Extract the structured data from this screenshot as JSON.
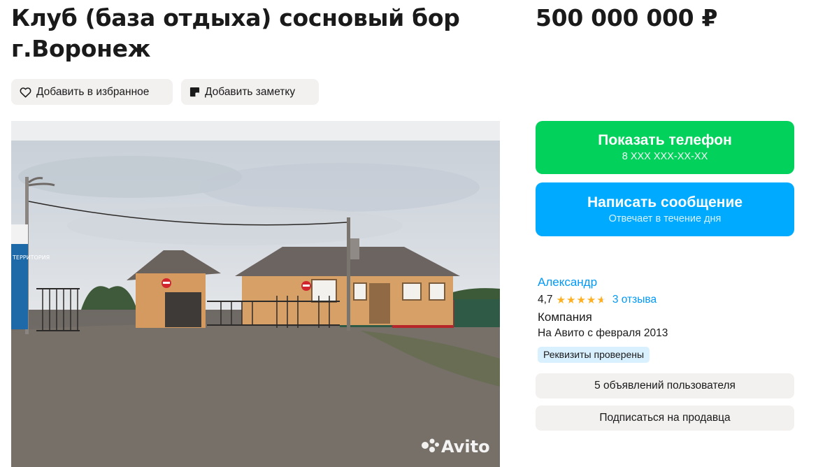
{
  "listing": {
    "title": "Клуб (база отдыха) сосновый бор г.Воронеж",
    "price": "500 000 000 ₽"
  },
  "actions": {
    "favorite_label": "Добавить в избранное",
    "favorite_icon": "heart-icon",
    "note_label": "Добавить заметку",
    "note_icon": "note-icon"
  },
  "photo": {
    "watermark": "Avito",
    "sign_text": "ТЕРРИТОРИЯ"
  },
  "contact": {
    "phone_label": "Показать телефон",
    "phone_masked": "8 XXX XXX-XX-XX",
    "message_label": "Написать сообщение",
    "message_sub": "Отвечает в течение дня",
    "phone_color": "#02d15c",
    "message_color": "#00aaff"
  },
  "seller": {
    "name": "Александр",
    "rating": "4,7",
    "rating_stars": 4.7,
    "reviews": "3 отзыва",
    "type": "Компания",
    "since": "На Авито с февраля 2013",
    "verified_badge": "Реквизиты проверены",
    "ads_button": "5 объявлений пользователя",
    "subscribe_button": "Подписаться на продавца"
  }
}
